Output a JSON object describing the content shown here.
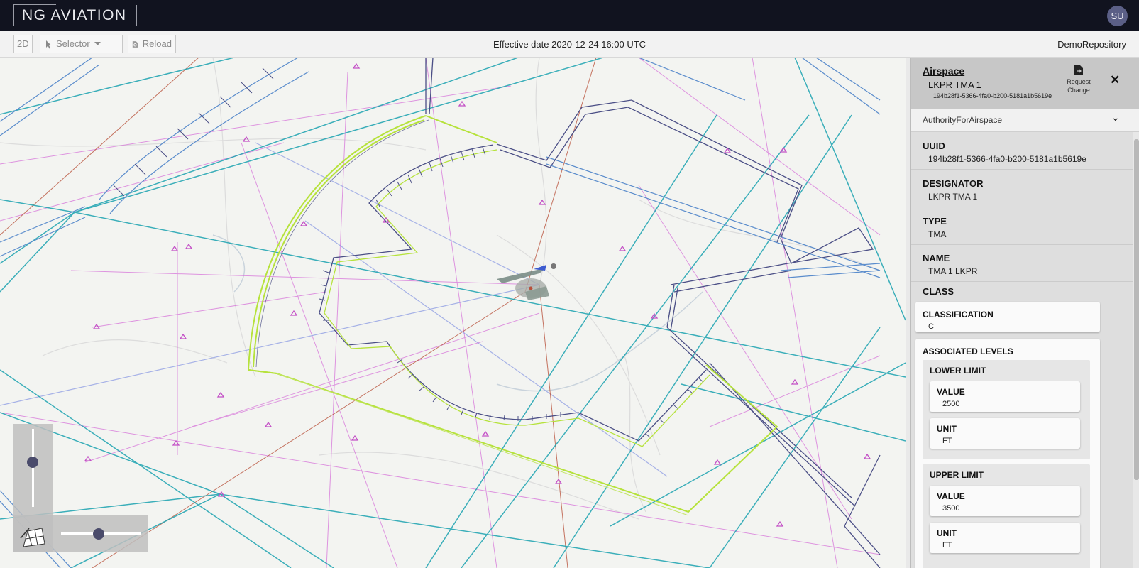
{
  "header": {
    "brand": "NG AVIATION",
    "user_initials": "SU"
  },
  "toolbar": {
    "view_mode_label": "2D",
    "selector_label": "Selector",
    "reload_label": "Reload",
    "effective_date": "Effective date 2020-12-24 16:00 UTC",
    "repository": "DemoRepository"
  },
  "colors": {
    "header_bg": "#11131f",
    "tma_outline": "#b6e23c",
    "airspace_dark": "#4b4f86",
    "airway_blue": "#5a8ccc",
    "route_teal": "#1aa2b0",
    "route_magenta": "#d56bd8",
    "route_red": "#b8503a"
  },
  "panel": {
    "title": "Airspace",
    "name": "LKPR TMA 1",
    "uuid_short": "194b28f1-5366-4fa0-b200-5181a1b5619e",
    "request_change_line1": "Request",
    "request_change_line2": "Change",
    "authority_link": "AuthorityForAirspace",
    "fields": [
      {
        "label": "UUID",
        "value": "194b28f1-5366-4fa0-b200-5181a1b5619e"
      },
      {
        "label": "DESIGNATOR",
        "value": "LKPR TMA 1"
      },
      {
        "label": "TYPE",
        "value": "TMA"
      },
      {
        "label": "NAME",
        "value": "TMA 1 LKPR"
      }
    ],
    "class_label": "CLASS",
    "classification": {
      "label": "CLASSIFICATION",
      "value": "C"
    },
    "associated_levels_label": "ASSOCIATED LEVELS",
    "lower_limit": {
      "label": "LOWER LIMIT",
      "value_label": "VALUE",
      "value": "2500",
      "unit_label": "UNIT",
      "unit": "FT"
    },
    "upper_limit": {
      "label": "UPPER LIMIT",
      "value_label": "VALUE",
      "value": "3500",
      "unit_label": "UNIT",
      "unit": "FT"
    }
  },
  "icons": {
    "selector": "cursor-arrow-icon",
    "reload": "file-reload-icon",
    "request_change": "file-export-icon",
    "close": "close-icon",
    "tilt": "map-tilt-icon"
  }
}
